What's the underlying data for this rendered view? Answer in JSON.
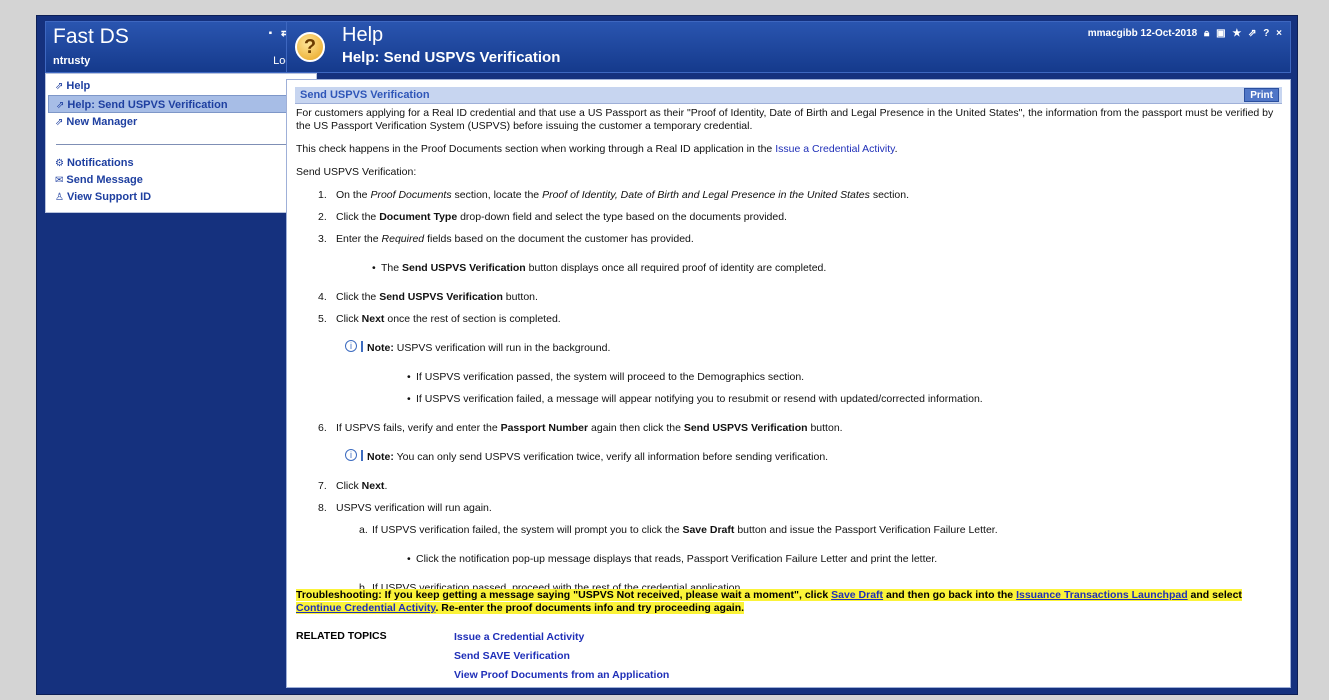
{
  "sidebar": {
    "app_title": "Fast DS",
    "controls": "▪ ⇄ ×",
    "user": "ntrusty",
    "logoff": "Log Off",
    "items": [
      {
        "icon": "⇗",
        "label": "Help",
        "close": "×"
      },
      {
        "icon": "⇗",
        "label": "Help: Send USPVS Verification",
        "close": "×"
      },
      {
        "icon": "⇗",
        "label": "New Manager"
      }
    ],
    "actions": [
      {
        "icon": "⚙",
        "label": "Notifications"
      },
      {
        "icon": "✉",
        "label": "Send Message"
      },
      {
        "icon": "♙",
        "label": "View Support ID"
      }
    ]
  },
  "header": {
    "title": "Help",
    "subtitle": "Help: Send USPVS Verification",
    "user_info": "mmacgibb  12-Oct-2018",
    "icons": [
      "lock",
      "image",
      "star",
      "external",
      "?",
      "×"
    ]
  },
  "section": {
    "title": "Send USPVS Verification",
    "print_label": "Print"
  },
  "content": {
    "intro": "For customers applying for a Real ID credential and that use a US Passport as their \"Proof of Identity, Date of Birth and Legal Presence in the United States\", the information from the passport must be verified by the US Passport Verification System (USPVS) before issuing the customer a temporary credential.",
    "check_prefix": "This check happens in the Proof Documents section when working through a Real ID application in the ",
    "check_link": "Issue a Credential Activity",
    "check_suffix": ".",
    "heading": "Send USPVS Verification:",
    "s1a": "On the ",
    "s1b": "Proof Documents",
    "s1c": " section, locate the ",
    "s1d": "Proof of Identity, Date of Birth and Legal Presence in the United States",
    "s1e": " section.",
    "s2a": "Click the ",
    "s2b": "Document Type",
    "s2c": " drop-down field and select the type based on the documents provided.",
    "s3a": "Enter the ",
    "s3b": "Required",
    "s3c": " fields based on the document the customer has provided.",
    "b1a": "The ",
    "b1b": "Send USPVS Verification",
    "b1c": " button displays once all required proof of identity are completed.",
    "s4a": "Click the ",
    "s4b": "Send USPVS Verification",
    "s4c": " button.",
    "s5a": "Click ",
    "s5b": "Next",
    "s5c": " once the rest of section is completed.",
    "n1a": "Note:",
    "n1b": " USPVS verification will run in the background.",
    "b2": "If USPVS verification passed, the system will proceed to the Demographics section.",
    "b3": "If USPVS verification failed, a message will appear notifying you to resubmit or resend with updated/corrected information.",
    "s6a": "If USPVS fails, verify and enter the ",
    "s6b": "Passport Number",
    "s6c": " again then click the ",
    "s6d": "Send USPVS Verification",
    "s6e": " button.",
    "n2a": "Note:",
    "n2b": " You can only send USPVS verification twice, verify all information before sending verification.",
    "s7a": "Click ",
    "s7b": "Next",
    "s7c": ".",
    "s8": "USPVS verification will run again.",
    "saa": "If USPVS verification failed, the system will prompt you to click the ",
    "sab": "Save Draft",
    "sac": " button and issue the Passport Verification Failure Letter.",
    "b4": "Click the notification pop-up message displays that reads, Passport Verification Failure Letter and print the letter.",
    "sb": "If USPVS verification passed, proceed with the rest of the credential application."
  },
  "troubleshooting": {
    "t1": "Troubleshooting: If you keep getting a message saying \"USPVS Not received, please wait a moment\", click ",
    "l1": "Save Draft",
    "t2": " and then go back into the ",
    "l2": "Issuance Transactions Launchpad",
    "t3": " and select ",
    "l3": "Continue Credential Activity",
    "t4": ". Re-enter the proof documents info and try proceeding again."
  },
  "related": {
    "label": "RELATED TOPICS",
    "links": [
      "Issue a Credential Activity",
      "Send SAVE Verification",
      "View Proof Documents from an Application"
    ]
  }
}
